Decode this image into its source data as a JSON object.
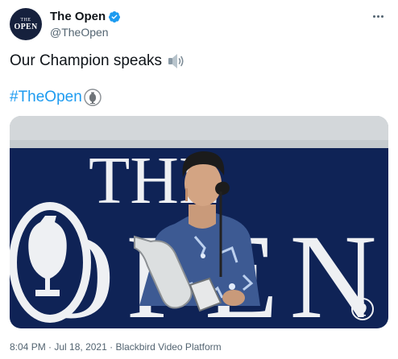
{
  "account": {
    "display_name": "The Open",
    "handle": "@TheOpen",
    "avatar_text_top": "THE",
    "avatar_text_bottom": "OPEN",
    "verified": true
  },
  "tweet": {
    "text": "Our Champion speaks",
    "speaker_emoji": "speaker-high-volume-icon",
    "hashtag": "#TheOpen",
    "hashtag_emoji": "claret-jug-icon"
  },
  "media": {
    "type": "video",
    "backdrop_text_top": "THE",
    "backdrop_text_bottom": "OPEN",
    "brand_icon": "claret-jug-icon"
  },
  "meta": {
    "time": "8:04 PM",
    "separator": " · ",
    "date": "Jul 18, 2021",
    "source": "Blackbird Video Platform"
  },
  "colors": {
    "link": "#1d9bf0",
    "secondary_text": "#536471",
    "backdrop_banner": "#0f2356",
    "verified": "#1d9bf0"
  }
}
